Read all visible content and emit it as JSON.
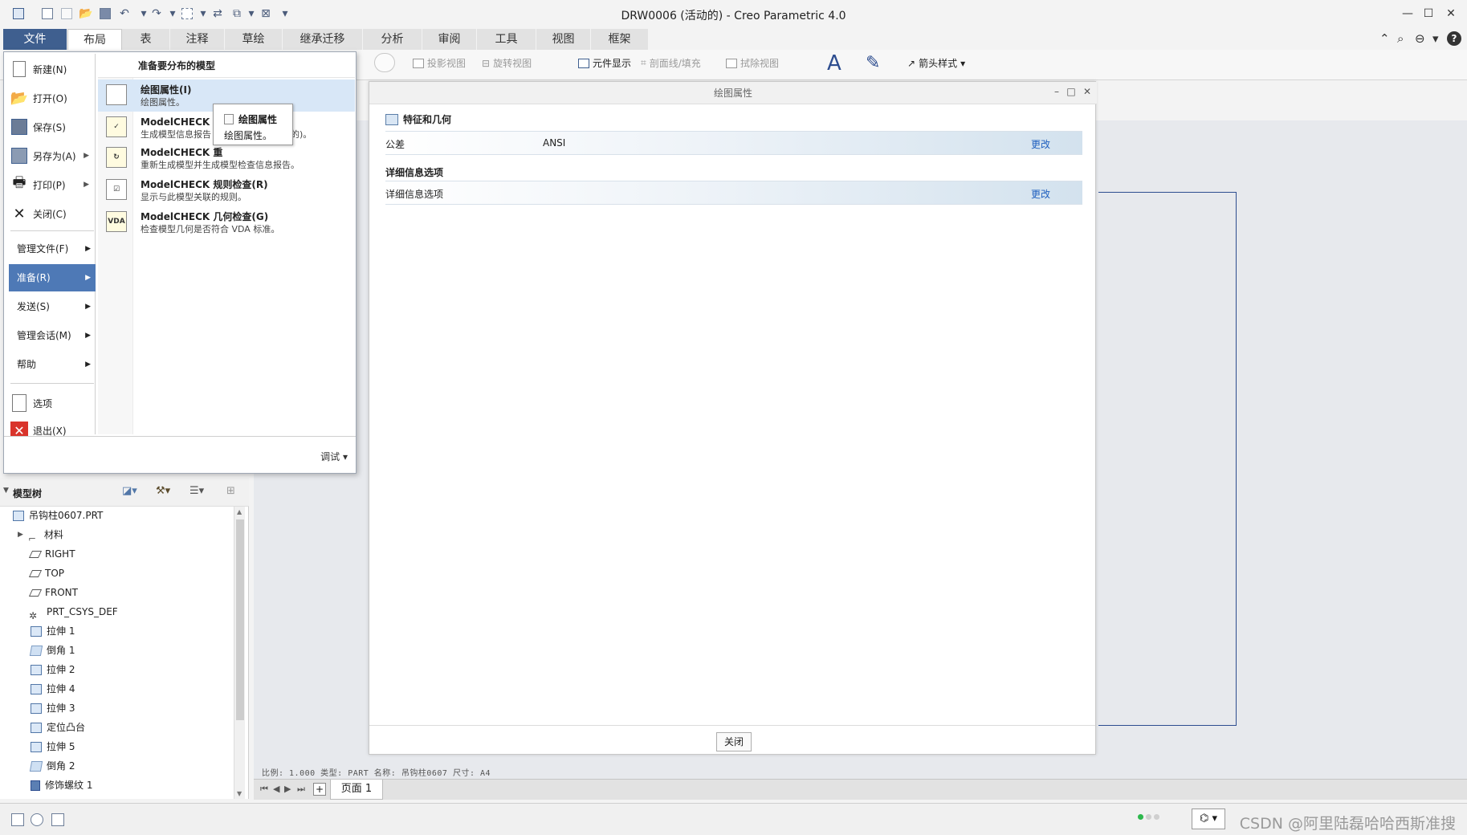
{
  "window": {
    "title": "DRW0006 (活动的) - Creo Parametric 4.0",
    "controls": {
      "minimize": "—",
      "maximize": "☐",
      "close": "✕"
    }
  },
  "ribbon": {
    "tabs": [
      "文件",
      "布局",
      "表",
      "注释",
      "草绘",
      "继承迁移",
      "分析",
      "审阅",
      "工具",
      "视图",
      "框架"
    ],
    "active_tab": "布局",
    "items": {
      "projection_view": "投影视图",
      "rotate_view": "旋转视图",
      "component_display": "元件显示",
      "section_fill": "剖面线/填充",
      "erase_view": "拭除视图",
      "arrow_style": "箭头样式"
    }
  },
  "file_menu": {
    "left": {
      "new": "新建(N)",
      "open": "打开(O)",
      "save": "保存(S)",
      "save_as": "另存为(A)",
      "print": "打印(P)",
      "close": "关闭(C)",
      "manage_file": "管理文件(F)",
      "prepare": "准备(R)",
      "send": "发送(S)",
      "manage_session": "管理会话(M)",
      "help": "帮助",
      "options": "选项",
      "exit": "退出(X)"
    },
    "right": {
      "header": "准备要分布的模型",
      "items": [
        {
          "title": "绘图属性(I)",
          "desc": "绘图属性。"
        },
        {
          "title": "ModelCHECK 交",
          "desc": "生成模型信息报告"
        },
        {
          "title": "ModelCHECK 重",
          "desc": "重新生成模型并生成模型检查信息报告。"
        },
        {
          "title": "ModelCHECK 规则检查(R)",
          "desc": "显示与此模型关联的规则。"
        },
        {
          "title": "ModelCHECK 几何检查(G)",
          "desc": "检查模型几何是否符合 VDA 标准。"
        }
      ],
      "desc_suffix": "的)。",
      "vda_label": "VDA"
    },
    "debug": "调试"
  },
  "tooltip": {
    "title": "绘图属性",
    "desc": "绘图属性。"
  },
  "dialog": {
    "title": "绘图属性",
    "section1": "特征和几何",
    "row1": {
      "label": "公差",
      "value": "ANSI",
      "action": "更改"
    },
    "section2": "详细信息选项",
    "row2": {
      "label": "详细信息选项",
      "action": "更改"
    },
    "close": "关闭"
  },
  "model_tree": {
    "title": "模型树",
    "items": [
      {
        "label": "吊钩柱0607.PRT",
        "icon": "part-icon"
      },
      {
        "label": "材料",
        "icon": "material-icon"
      },
      {
        "label": "RIGHT",
        "icon": "datum-plane-icon"
      },
      {
        "label": "TOP",
        "icon": "datum-plane-icon"
      },
      {
        "label": "FRONT",
        "icon": "datum-plane-icon"
      },
      {
        "label": "PRT_CSYS_DEF",
        "icon": "csys-icon"
      },
      {
        "label": "拉伸 1",
        "icon": "extrude-icon"
      },
      {
        "label": "倒角 1",
        "icon": "chamfer-icon"
      },
      {
        "label": "拉伸 2",
        "icon": "extrude-icon"
      },
      {
        "label": "拉伸 4",
        "icon": "extrude-icon"
      },
      {
        "label": "拉伸 3",
        "icon": "extrude-icon"
      },
      {
        "label": "定位凸台",
        "icon": "extrude-icon"
      },
      {
        "label": "拉伸 5",
        "icon": "extrude-icon"
      },
      {
        "label": "倒角 2",
        "icon": "chamfer-icon"
      },
      {
        "label": "修饰螺纹 1",
        "icon": "thread-icon"
      }
    ]
  },
  "status": {
    "drawing_info": "比例: 1.000    类型: PART    名称: 吊钩柱0607    尺寸: A4",
    "page_tab": "页面 1",
    "watermark": "CSDN @阿里陆磊哈哈西斯准搜"
  }
}
